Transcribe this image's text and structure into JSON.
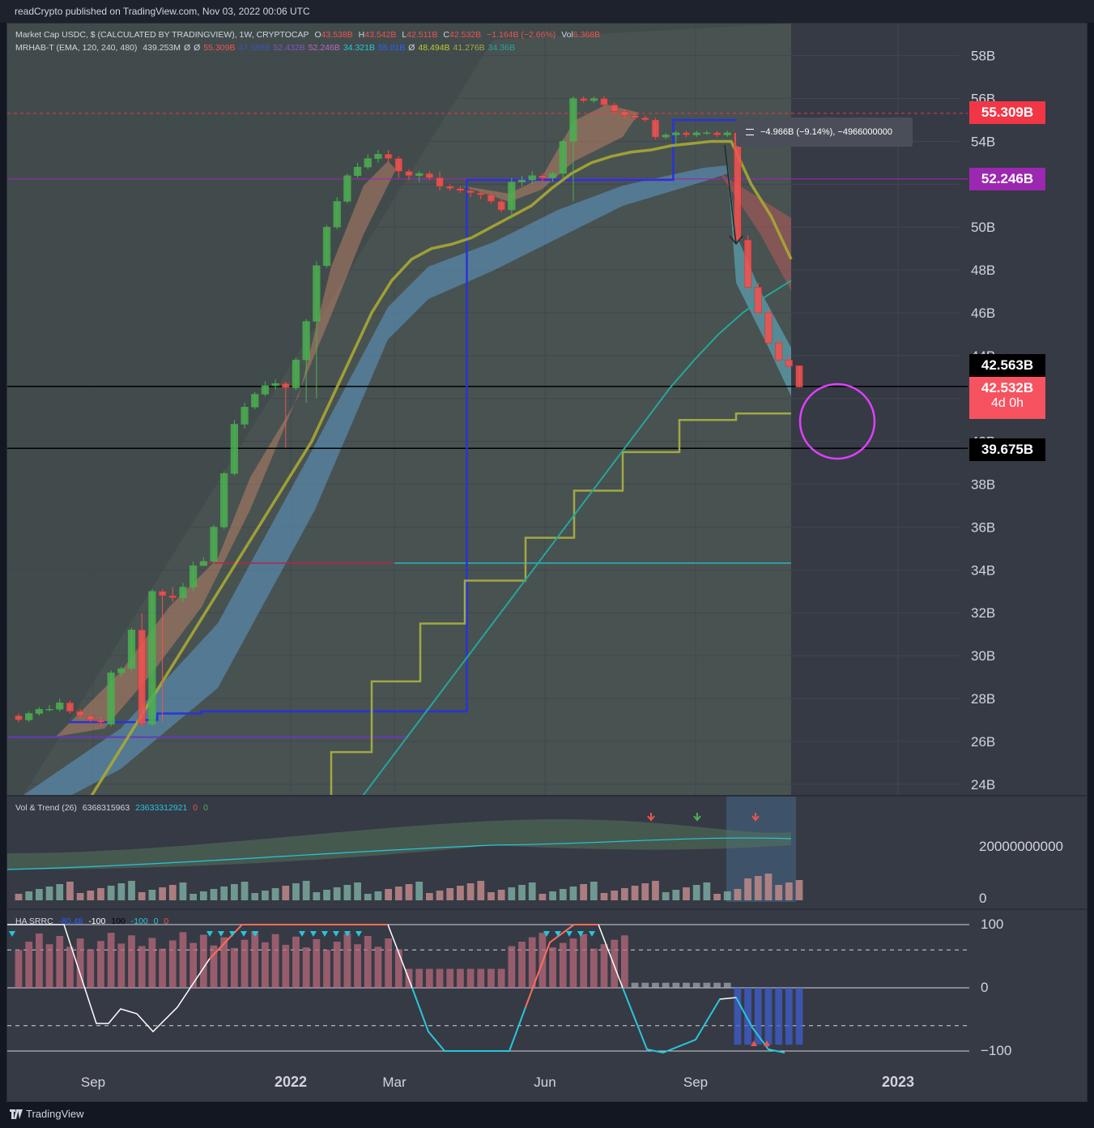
{
  "header": {
    "publisher_line": "readCrypto published on TradingView.com, Nov 03, 2022 00:06 UTC"
  },
  "footer": {
    "brand": "TradingView"
  },
  "main_legend": {
    "symbol": "Market Cap USDC, $ (CALCULATED BY TRADINGVIEW), 1W, CRYPTOCAP",
    "open_label": "O",
    "open": "43.538B",
    "high_label": "H",
    "high": "43.542B",
    "low_label": "L",
    "low": "42.511B",
    "close_label": "C",
    "close": "42.532B",
    "change": "−1.164B (−2.66%)",
    "vol_label": "Vol",
    "vol": "6.368B"
  },
  "indicator_legend": {
    "name": "MRHAB-T (EMA, 120, 240, 480)",
    "values": [
      "439.253M",
      "Ø",
      "Ø",
      "55.309B",
      "47.588B",
      "52.432B",
      "52.246B",
      "34.321B",
      "55.01B",
      "Ø",
      "48.494B",
      "41.276B",
      "34.36B"
    ],
    "colors": [
      "#d1d4dc",
      "#d1d4dc",
      "#d1d4dc",
      "#ef5350",
      "#3f51b5",
      "#7e57c2",
      "#ba68c8",
      "#26c6da",
      "#2962ff",
      "#d1d4dc",
      "#c0ca33",
      "#a1a843",
      "#26a69a"
    ]
  },
  "volume_legend": {
    "name": "Vol & Trend (26)",
    "v1": "6368315963",
    "v2": "23633312921",
    "v3": "0",
    "v4": "0"
  },
  "srrc_legend": {
    "name": "HA SRRC",
    "v1": "-80.48",
    "v2": "-100",
    "v3": "100",
    "v4": "-100",
    "v5": "0",
    "v6": "0"
  },
  "measure": {
    "text": "−4.966B (−9.14%), −4966000000"
  },
  "price_tags": {
    "red": "55.309B",
    "purple": "52.246B",
    "black_top": "42.563B",
    "last_price": "42.532B",
    "countdown": "4d 0h",
    "black_bottom": "39.675B"
  },
  "volume_axis": {
    "top": "20000000000",
    "bottom": "0"
  },
  "srrc_axis": {
    "top": "100",
    "mid": "0",
    "bottom": "−100"
  },
  "colors": {
    "up": "#4caf50",
    "down": "#ef5350",
    "background": "#363a45",
    "circle": "#e040fb"
  },
  "chart_data": {
    "type": "candlestick",
    "title": "Market Cap USDC, $ (CALCULATED BY TRADINGVIEW), 1W, CRYPTOCAP",
    "y_unit": "B",
    "ylim": [
      23.5,
      59.5
    ],
    "y_ticks": [
      "24B",
      "26B",
      "28B",
      "30B",
      "32B",
      "34B",
      "36B",
      "38B",
      "40B",
      "42B",
      "44B",
      "46B",
      "48B",
      "50B",
      "52B",
      "54B",
      "56B",
      "58B"
    ],
    "x_ticks": [
      "Sep",
      "2022",
      "Mar",
      "Jun",
      "Sep",
      "2023"
    ],
    "horizontal_levels": [
      55.309,
      52.246,
      42.563,
      39.675,
      34.321
    ],
    "candles": [
      [
        27.2,
        27.0,
        26.9,
        27.3
      ],
      [
        27.0,
        27.3,
        26.9,
        27.4
      ],
      [
        27.3,
        27.5,
        27.2,
        27.6
      ],
      [
        27.5,
        27.5,
        27.4,
        27.7
      ],
      [
        27.5,
        27.8,
        27.4,
        28.0
      ],
      [
        27.8,
        27.4,
        27.3,
        27.9
      ],
      [
        27.4,
        27.2,
        27.1,
        27.5
      ],
      [
        27.2,
        27.0,
        26.9,
        27.3
      ],
      [
        27.0,
        26.9,
        26.7,
        27.1
      ],
      [
        26.8,
        29.2,
        26.7,
        29.3
      ],
      [
        29.2,
        29.4,
        29.0,
        29.5
      ],
      [
        29.4,
        31.2,
        29.3,
        31.3
      ],
      [
        31.2,
        26.8,
        26.7,
        32.0
      ],
      [
        26.8,
        33.0,
        26.7,
        33.1
      ],
      [
        33.0,
        32.8,
        26.9,
        33.1
      ],
      [
        32.8,
        32.7,
        32.5,
        33.2
      ],
      [
        32.7,
        33.2,
        32.5,
        33.4
      ],
      [
        33.2,
        34.2,
        33.0,
        34.4
      ],
      [
        34.2,
        34.4,
        34.2,
        34.6
      ],
      [
        34.4,
        36.0,
        34.3,
        36.1
      ],
      [
        36.0,
        38.5,
        35.9,
        38.6
      ],
      [
        38.5,
        40.8,
        38.4,
        41.0
      ],
      [
        40.8,
        41.6,
        40.6,
        41.8
      ],
      [
        41.6,
        42.2,
        41.5,
        42.3
      ],
      [
        42.2,
        42.6,
        42.1,
        42.8
      ],
      [
        42.6,
        42.7,
        42.4,
        42.9
      ],
      [
        42.7,
        42.5,
        39.7,
        42.8
      ],
      [
        42.5,
        43.8,
        42.4,
        43.9
      ],
      [
        43.8,
        45.6,
        41.8,
        45.7
      ],
      [
        45.6,
        48.2,
        42.0,
        48.4
      ],
      [
        48.2,
        50.0,
        48.1,
        50.1
      ],
      [
        50.0,
        51.2,
        49.9,
        51.4
      ],
      [
        51.2,
        52.4,
        51.1,
        52.5
      ],
      [
        52.4,
        52.8,
        52.3,
        53.0
      ],
      [
        52.8,
        53.2,
        52.7,
        53.4
      ],
      [
        53.2,
        53.4,
        53.0,
        53.6
      ],
      [
        53.4,
        53.2,
        53.0,
        53.6
      ],
      [
        53.2,
        52.6,
        52.3,
        53.3
      ],
      [
        52.6,
        52.4,
        52.2,
        52.7
      ],
      [
        52.4,
        52.5,
        52.1,
        52.6
      ],
      [
        52.5,
        52.3,
        52.2,
        52.6
      ],
      [
        52.3,
        51.9,
        51.7,
        52.6
      ],
      [
        51.9,
        51.8,
        51.7,
        52.0
      ],
      [
        51.8,
        51.7,
        51.6,
        51.9
      ],
      [
        51.7,
        51.6,
        51.4,
        51.8
      ],
      [
        51.6,
        51.5,
        51.3,
        51.7
      ],
      [
        51.5,
        51.2,
        51.1,
        51.6
      ],
      [
        51.2,
        50.8,
        50.7,
        51.3
      ],
      [
        50.8,
        52.1,
        50.4,
        52.3
      ],
      [
        52.1,
        52.2,
        51.9,
        52.4
      ],
      [
        52.2,
        52.4,
        52.0,
        52.6
      ],
      [
        52.4,
        52.3,
        52.1,
        52.5
      ],
      [
        52.3,
        52.5,
        52.1,
        52.6
      ],
      [
        52.5,
        54.0,
        52.3,
        54.1
      ],
      [
        54.0,
        56.0,
        51.2,
        56.1
      ],
      [
        56.0,
        55.9,
        55.8,
        56.1
      ],
      [
        55.9,
        56.0,
        55.8,
        56.1
      ],
      [
        56.0,
        55.7,
        55.6,
        56.1
      ],
      [
        55.7,
        55.4,
        55.3,
        55.8
      ],
      [
        55.4,
        55.2,
        55.1,
        55.5
      ],
      [
        55.2,
        55.1,
        55.0,
        55.3
      ],
      [
        55.1,
        55.0,
        54.9,
        55.2
      ],
      [
        55.0,
        54.2,
        54.1,
        55.1
      ],
      [
        54.2,
        54.3,
        54.1,
        54.4
      ],
      [
        54.3,
        54.4,
        53.8,
        54.5
      ],
      [
        54.4,
        54.3,
        54.2,
        54.5
      ],
      [
        54.3,
        54.4,
        54.2,
        54.5
      ],
      [
        54.4,
        54.4,
        54.3,
        54.5
      ],
      [
        54.4,
        54.3,
        54.2,
        54.5
      ],
      [
        54.3,
        54.4,
        54.2,
        54.5
      ],
      [
        54.4,
        49.4,
        49.3,
        54.4
      ],
      [
        49.4,
        47.2,
        47.0,
        49.6
      ],
      [
        47.2,
        46.0,
        45.9,
        47.4
      ],
      [
        46.0,
        44.6,
        44.5,
        46.2
      ],
      [
        44.6,
        43.8,
        43.6,
        44.8
      ],
      [
        43.8,
        43.5,
        43.4,
        44.0
      ],
      [
        43.538,
        42.532,
        42.511,
        43.542
      ]
    ],
    "series": [
      {
        "name": "MRHAB-T trend",
        "values": [
          26.9,
          26.9,
          26.9,
          26.9,
          26.9,
          27.0,
          27.3,
          27.3,
          27.3,
          27.4,
          27.4,
          27.4,
          27.4,
          27.4,
          27.4,
          27.4,
          27.4,
          27.4,
          27.4,
          27.4,
          27.4,
          27.4,
          27.4,
          27.4,
          27.4,
          27.4,
          27.4,
          52.2,
          52.2,
          52.2,
          52.2,
          52.2,
          52.2,
          52.2,
          52.2,
          52.2,
          52.2,
          52.2,
          52.2,
          52.2,
          52.2,
          55.0,
          55.0,
          55.0,
          55.0,
          55.0,
          55.0,
          55.0,
          55.0,
          55.0
        ]
      },
      {
        "name": "Yellow EMA",
        "values": [
          22.0,
          23.5,
          25.0,
          26.5,
          28.0,
          29.5,
          31.0,
          32.5,
          34.0,
          35.5,
          37.0,
          38.5,
          40.0,
          42.0,
          44.0,
          46.0,
          47.5,
          48.5,
          49.0,
          49.2,
          49.5,
          50.0,
          50.5,
          51.0,
          51.8,
          52.5,
          53.0,
          53.3,
          53.5,
          53.6,
          53.8,
          53.9,
          54.0,
          54.0,
          52.0,
          50.5,
          48.5
        ]
      },
      {
        "name": "Teal EMA",
        "values": [
          22.0,
          23.0,
          24.5,
          26.0,
          27.5,
          29.0,
          30.5,
          32.0,
          33.5,
          35.0,
          36.5,
          38.0,
          39.5,
          41.0,
          42.5,
          43.8,
          45.0,
          46.0,
          46.8,
          47.5
        ]
      }
    ]
  }
}
